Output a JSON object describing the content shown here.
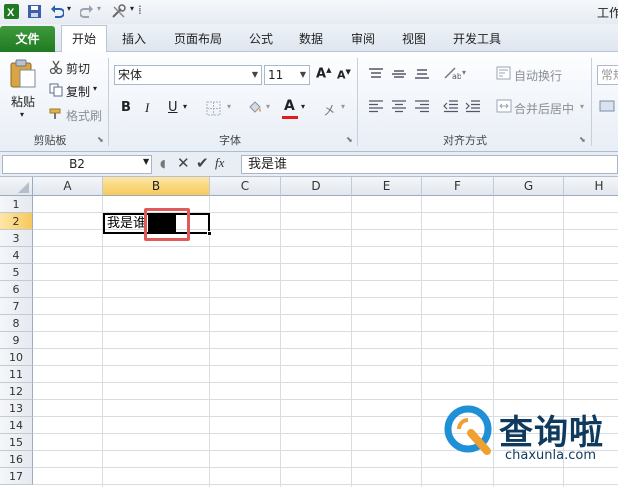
{
  "quick_access": {
    "title_partial": "工作"
  },
  "tabs": [
    "文件",
    "开始",
    "插入",
    "页面布局",
    "公式",
    "数据",
    "审阅",
    "视图",
    "开发工具"
  ],
  "ribbon": {
    "clipboard": {
      "paste": "粘贴",
      "cut": "剪切",
      "copy": "复制",
      "format_painter": "格式刷",
      "group": "剪贴板"
    },
    "font": {
      "name": "宋体",
      "size": "11",
      "bold": "B",
      "italic": "I",
      "underline": "U",
      "group": "字体"
    },
    "alignment": {
      "wrap": "自动换行",
      "merge": "合并后居中",
      "group": "对齐方式"
    },
    "number": {
      "format": "常规"
    }
  },
  "formula_bar": {
    "name_box": "B2",
    "content": "我是谁",
    "fx": "fx"
  },
  "sheet": {
    "columns": [
      "A",
      "B",
      "C",
      "D",
      "E",
      "F",
      "G",
      "H"
    ],
    "selected_column": "B",
    "rows": [
      "1",
      "2",
      "3",
      "4",
      "5",
      "6",
      "7",
      "8",
      "9",
      "10",
      "11",
      "12",
      "13",
      "14",
      "15",
      "16",
      "17"
    ],
    "selected_row": "2",
    "cell_b2": "我是谁"
  },
  "watermark": {
    "brand": "查询啦",
    "domain": "chaxunla.com"
  },
  "colors": {
    "accent": "#217346",
    "selection": "#f7c95a",
    "highlight": "#e05a5a"
  }
}
